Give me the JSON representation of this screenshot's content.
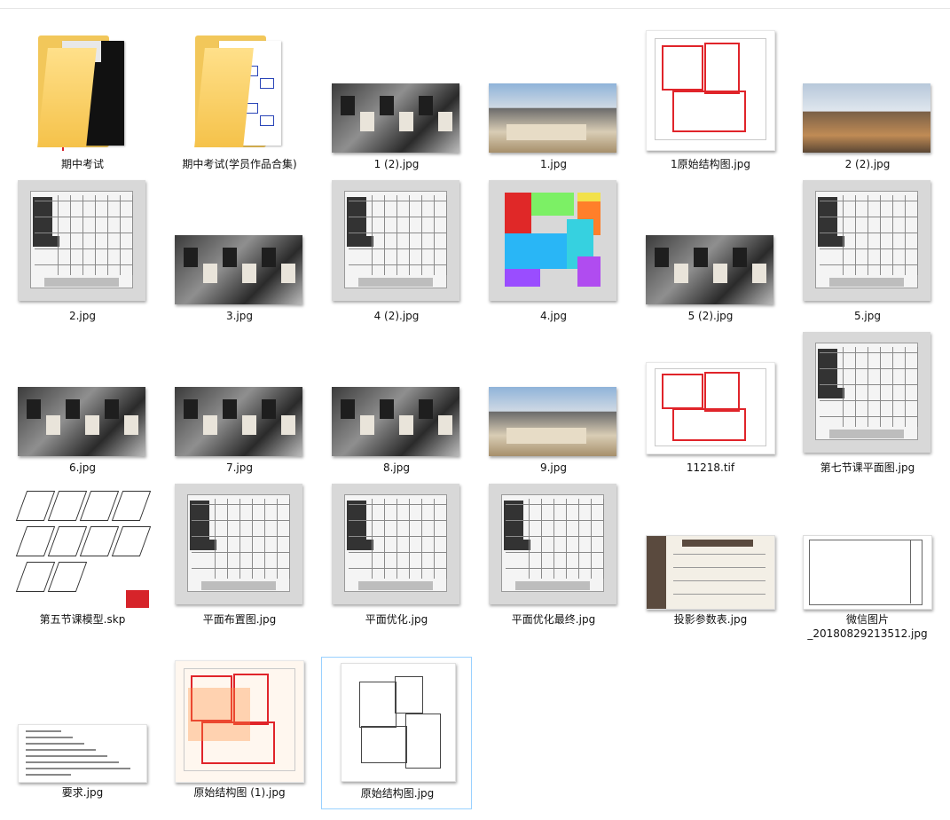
{
  "window": {
    "path_text": ""
  },
  "files": [
    {
      "name": "期中考试",
      "kind": "folder-dark"
    },
    {
      "name": "期中考试(学员作品合集)",
      "kind": "folder-plan"
    },
    {
      "name": "1 (2).jpg",
      "kind": "photo-dark"
    },
    {
      "name": "1.jpg",
      "kind": "photo-room"
    },
    {
      "name": "1原始结构图.jpg",
      "kind": "redplan"
    },
    {
      "name": "2 (2).jpg",
      "kind": "photo-terrace"
    },
    {
      "name": "2.jpg",
      "kind": "plan-gray"
    },
    {
      "name": "3.jpg",
      "kind": "photo-dark"
    },
    {
      "name": "4 (2).jpg",
      "kind": "plan-gray"
    },
    {
      "name": "4.jpg",
      "kind": "colorplan"
    },
    {
      "name": "5 (2).jpg",
      "kind": "photo-dark"
    },
    {
      "name": "5.jpg",
      "kind": "plan-gray"
    },
    {
      "name": "6.jpg",
      "kind": "photo-dark"
    },
    {
      "name": "7.jpg",
      "kind": "photo-dark"
    },
    {
      "name": "8.jpg",
      "kind": "photo-dark"
    },
    {
      "name": "9.jpg",
      "kind": "photo-room"
    },
    {
      "name": "11218.tif",
      "kind": "redplan-wide"
    },
    {
      "name": "第七节课平面图.jpg",
      "kind": "plan-gray"
    },
    {
      "name": "第五节课模型.skp",
      "kind": "skp"
    },
    {
      "name": "平面布置图.jpg",
      "kind": "plan-gray"
    },
    {
      "name": "平面优化.jpg",
      "kind": "plan-gray"
    },
    {
      "name": "平面优化最终.jpg",
      "kind": "plan-gray"
    },
    {
      "name": "投影参数表.jpg",
      "kind": "table-doc"
    },
    {
      "name": "微信图片\n_20180829213512.jpg",
      "kind": "cad-sheet"
    },
    {
      "name": "要求.jpg",
      "kind": "textdoc"
    },
    {
      "name": "原始结构图 (1).jpg",
      "kind": "redplan-tall"
    },
    {
      "name": "原始结构图.jpg",
      "kind": "plan-white",
      "selected": true
    }
  ],
  "colors": {
    "selection_border": "#99d1ff",
    "folder": "#f5c24a",
    "wall_red": "#e0242a"
  }
}
